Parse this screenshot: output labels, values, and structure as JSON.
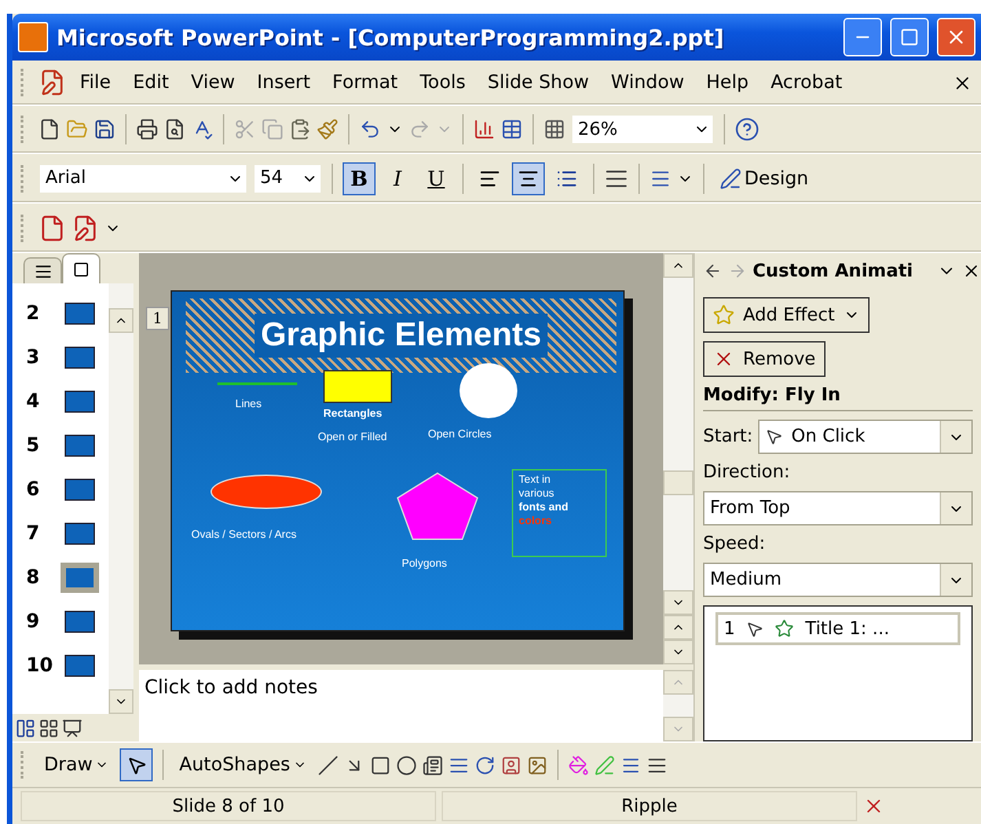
{
  "window": {
    "title": "Microsoft PowerPoint - [ComputerProgramming2.ppt]"
  },
  "menu": [
    "File",
    "Edit",
    "View",
    "Insert",
    "Format",
    "Tools",
    "Slide Show",
    "Window",
    "Help",
    "Acrobat"
  ],
  "standard_toolbar": {
    "zoom": "26%"
  },
  "formatting_toolbar": {
    "font": "Arial",
    "size": "54",
    "design": "Design",
    "buttons": [
      {
        "kind": "bold",
        "label": "B",
        "on": true
      },
      {
        "kind": "italic",
        "label": "I",
        "on": false
      },
      {
        "kind": "underline",
        "label": "U",
        "on": false
      },
      {
        "kind": "align-left",
        "on": false
      },
      {
        "kind": "align-center",
        "on": true
      },
      {
        "kind": "bullets",
        "on": false
      }
    ]
  },
  "pane_tabs": [
    {
      "kind": "outline",
      "selected": false
    },
    {
      "kind": "slides",
      "selected": true
    }
  ],
  "thumbnails": [
    {
      "number": "2",
      "selected": false
    },
    {
      "number": "3",
      "selected": false
    },
    {
      "number": "4",
      "selected": false
    },
    {
      "number": "5",
      "selected": false
    },
    {
      "number": "6",
      "selected": false
    },
    {
      "number": "7",
      "selected": false
    },
    {
      "number": "8",
      "selected": true
    },
    {
      "number": "9",
      "selected": false
    },
    {
      "number": "10",
      "selected": false
    }
  ],
  "slide": {
    "title": "Graphic Elements",
    "animation_tag": "1",
    "lines": "Lines",
    "rectangles": "Rectangles",
    "open_or_filled": "Open or Filled",
    "open_circles": "Open Circles",
    "ovals": "Ovals / Sectors / Arcs",
    "polygons": "Polygons",
    "text_box": [
      "Text in",
      "various",
      "fonts and",
      "colors"
    ]
  },
  "notes": {
    "placeholder": "Click to add notes"
  },
  "task_pane": {
    "title": "Custom Animati",
    "add_effect": "Add Effect",
    "remove": "Remove",
    "modify": "Modify: Fly In",
    "start_label": "Start:",
    "start": "On Click",
    "direction_label": "Direction:",
    "direction": "From Top",
    "speed_label": "Speed:",
    "speed": "Medium",
    "effects": [
      {
        "order": "1",
        "name": "Title 1: ..."
      }
    ]
  },
  "drawing_toolbar": {
    "draw": "Draw",
    "autoshapes": "AutoShapes"
  },
  "status_bar": [
    "Slide 8 of 10",
    "Ripple"
  ]
}
